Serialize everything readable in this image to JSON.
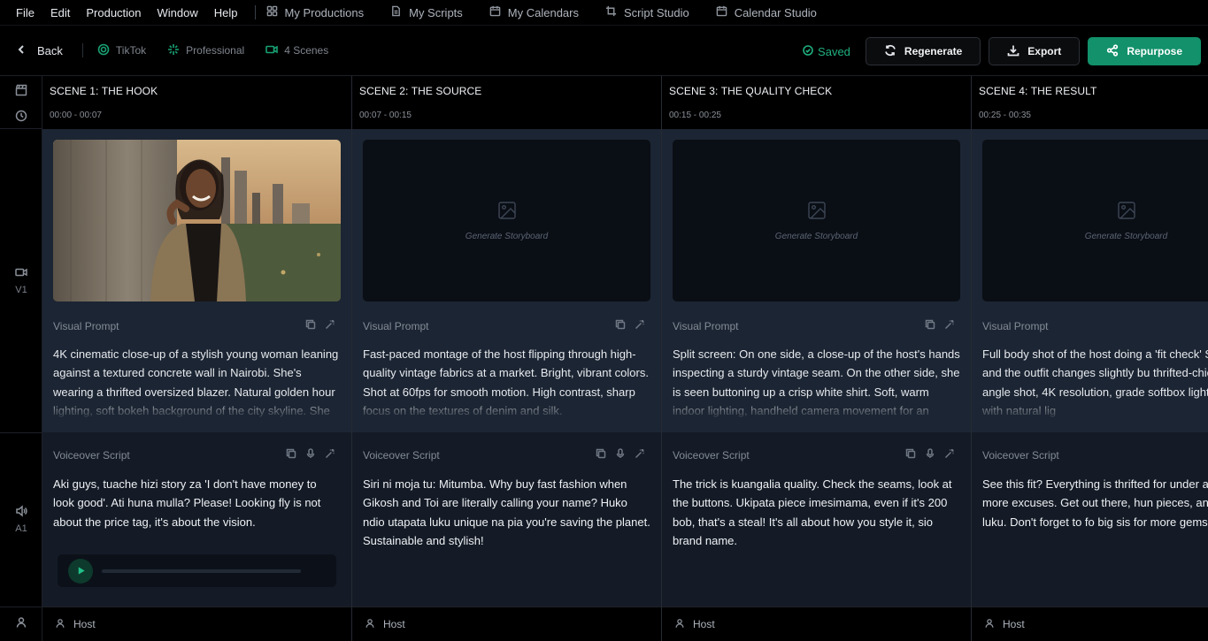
{
  "menu": {
    "items": [
      "File",
      "Edit",
      "Production",
      "Window",
      "Help"
    ],
    "links": [
      {
        "label": "My Productions",
        "icon": "grid-icon"
      },
      {
        "label": "My Scripts",
        "icon": "document-icon"
      },
      {
        "label": "My Calendars",
        "icon": "calendar-icon"
      },
      {
        "label": "Script Studio",
        "icon": "crop-icon"
      },
      {
        "label": "Calendar Studio",
        "icon": "calendar-icon"
      }
    ]
  },
  "toolbar": {
    "back_label": "Back",
    "platform": "TikTok",
    "tone": "Professional",
    "scene_count": "4 Scenes",
    "saved_label": "Saved",
    "regenerate_label": "Regenerate",
    "export_label": "Export",
    "repurpose_label": "Repurpose",
    "accent_color": "#12916a"
  },
  "gutter": {
    "video_track": "V1",
    "audio_track": "A1"
  },
  "scenes": [
    {
      "title": "SCENE 1: THE HOOK",
      "time": "00:00 - 00:07",
      "has_image": true,
      "placeholder": "",
      "visual_label": "Visual Prompt",
      "visual_prompt": "4K cinematic close-up of a stylish young woman leaning against a textured concrete wall in Nairobi. She's wearing a thrifted oversized blazer. Natural golden hour lighting, soft bokeh background of the city skyline. She",
      "voice_label": "Voiceover Script",
      "voice_script": "Aki guys, tuache hizi story za 'I don't have money to look good'. Ati huna mulla? Please! Looking fly is not about the price tag, it's about the vision.",
      "has_audio": true,
      "character": "Host"
    },
    {
      "title": "SCENE 2: THE SOURCE",
      "time": "00:07 - 00:15",
      "has_image": false,
      "placeholder": "Generate Storyboard",
      "visual_label": "Visual Prompt",
      "visual_prompt": "Fast-paced montage of the host flipping through high-quality vintage fabrics at a market. Bright, vibrant colors. Shot at 60fps for smooth motion. High contrast, sharp focus on the textures of denim and silk.",
      "voice_label": "Voiceover Script",
      "voice_script": "Siri ni moja tu: Mitumba. Why buy fast fashion when Gikosh and Toi are literally calling your name? Huko ndio utapata luku unique na pia you're saving the planet. Sustainable and stylish!",
      "has_audio": false,
      "character": "Host"
    },
    {
      "title": "SCENE 3: THE QUALITY CHECK",
      "time": "00:15 - 00:25",
      "has_image": false,
      "placeholder": "Generate Storyboard",
      "visual_label": "Visual Prompt",
      "visual_prompt": "Split screen: On one side, a close-up of the host's hands inspecting a sturdy vintage seam. On the other side, she is seen buttoning up a crisp white shirt. Soft, warm indoor lighting, handheld camera movement for an",
      "voice_label": "Voiceover Script",
      "voice_script": "The trick is kuangalia quality. Check the seams, look at the buttons. Ukipata piece imesimama, even if it's 200 bob, that's a steal! It's all about how you style it, sio brand name.",
      "has_audio": false,
      "character": "Host"
    },
    {
      "title": "SCENE 4: THE RESULT",
      "time": "00:25 - 00:35",
      "has_image": false,
      "placeholder": "Generate Storyboard",
      "visual_label": "Visual Prompt",
      "visual_prompt": "Full body shot of the host doing a 'fit check' She spins, and the outfit changes slightly bu thrifted-chic. High-angle shot, 4K resolution, grade softbox lighting mixed with natural lig",
      "voice_label": "Voiceover Script",
      "voice_script": "See this fit? Everything is thrifted for under a please, no more excuses. Get out there, hun pieces, and serve that luku. Don't forget to fo big sis for more gems. Tuonane!",
      "has_audio": false,
      "character": "Host"
    }
  ]
}
